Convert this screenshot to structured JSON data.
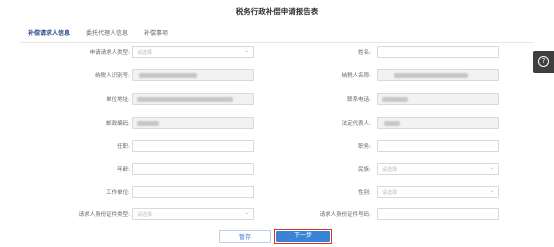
{
  "title": "税务行政补偿申请报告表",
  "tabs": [
    {
      "label": "补偿请求人信息",
      "active": true
    },
    {
      "label": "委托代理人信息",
      "active": false
    },
    {
      "label": "补偿事项",
      "active": false
    }
  ],
  "form": {
    "requester_type": {
      "label": "申请请求人类型:",
      "placeholder": "请选择"
    },
    "name": {
      "label": "姓名:",
      "value": ""
    },
    "taxpayer_id": {
      "label": "纳税人识别号:"
    },
    "taxpayer_name": {
      "label": "纳税人名称:"
    },
    "address": {
      "label": "单位地址:"
    },
    "phone": {
      "label": "联系电话:"
    },
    "postcode": {
      "label": "邮政编码:"
    },
    "legal_rep": {
      "label": "法定代表人:"
    },
    "position": {
      "label": "任职:",
      "value": ""
    },
    "duty": {
      "label": "职务:",
      "value": ""
    },
    "age": {
      "label": "年龄:",
      "value": ""
    },
    "ethnicity": {
      "label": "民族:",
      "placeholder": "请选择"
    },
    "employer": {
      "label": "工作单位:",
      "value": ""
    },
    "gender": {
      "label": "性别:",
      "placeholder": "请选择"
    },
    "id_type": {
      "label": "请求人身份证件类型:",
      "placeholder": "请选择"
    },
    "id_number": {
      "label": "请求人身份证件号码:",
      "value": ""
    }
  },
  "buttons": {
    "save": "暂存",
    "next": "下一步"
  },
  "side": {
    "help_icon": "?"
  }
}
